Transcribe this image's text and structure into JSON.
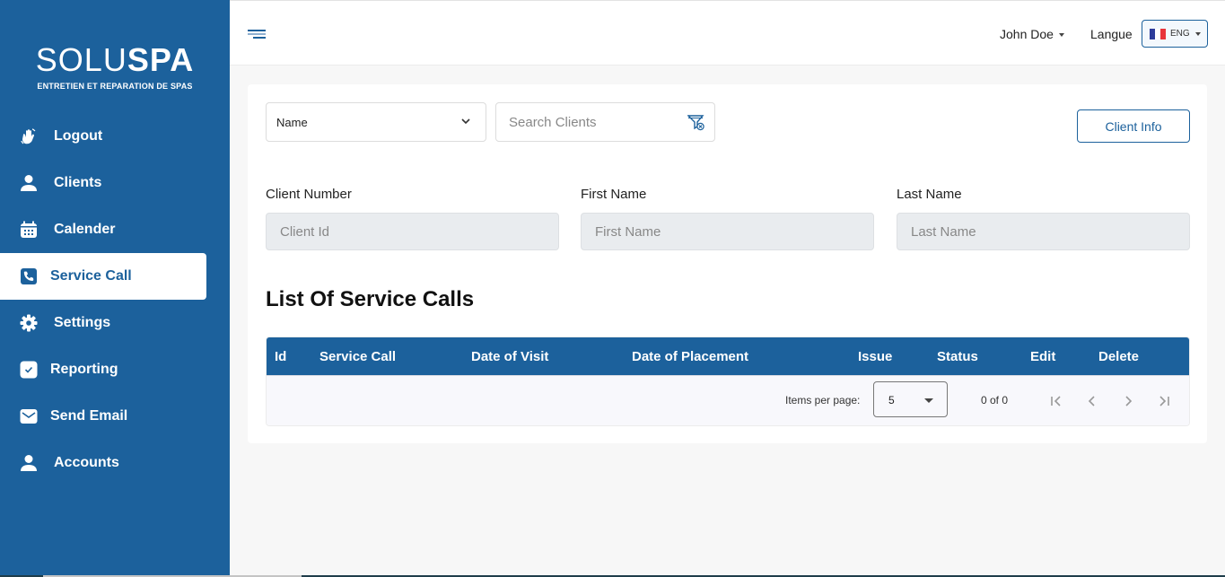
{
  "brand": {
    "name_light": "SOLU",
    "name_bold": "SPA",
    "tagline": "ENTRETIEN ET REPARATION DE SPAS",
    "primary_color": "#1c619c"
  },
  "sidebar": {
    "items": [
      {
        "label": "Logout",
        "icon": "waving-hand-icon",
        "active": false
      },
      {
        "label": "Clients",
        "icon": "user-icon",
        "active": false
      },
      {
        "label": "Calender",
        "icon": "calendar-icon",
        "active": false
      },
      {
        "label": "Service Call",
        "icon": "phone-icon",
        "active": true
      },
      {
        "label": "Settings",
        "icon": "gear-icon",
        "active": false
      },
      {
        "label": "Reporting",
        "icon": "check-square-icon",
        "active": false
      },
      {
        "label": "Send Email",
        "icon": "envelope-icon",
        "active": false
      },
      {
        "label": "Accounts",
        "icon": "user-icon",
        "active": false
      }
    ]
  },
  "topbar": {
    "user_name": "John Doe",
    "language_label": "Langue",
    "language_code": "ENG",
    "flag_colors": [
      "#2d3c9a",
      "#ffffff",
      "#e8343a"
    ]
  },
  "search": {
    "filter_select_value": "Name",
    "search_placeholder": "Search Clients",
    "client_info_label": "Client Info"
  },
  "client_fields": [
    {
      "label": "Client Number",
      "placeholder": "Client Id"
    },
    {
      "label": "First Name",
      "placeholder": "First Name"
    },
    {
      "label": "Last Name",
      "placeholder": "Last Name"
    }
  ],
  "service_calls": {
    "title": "List Of Service Calls",
    "columns": [
      "Id",
      "Service Call",
      "Date of Visit",
      "Date of Placement",
      "Issue",
      "Status",
      "Edit",
      "Delete"
    ],
    "rows": [],
    "paginator": {
      "items_per_page_label": "Items per page:",
      "items_per_page": "5",
      "range_label": "0 of 0"
    }
  }
}
